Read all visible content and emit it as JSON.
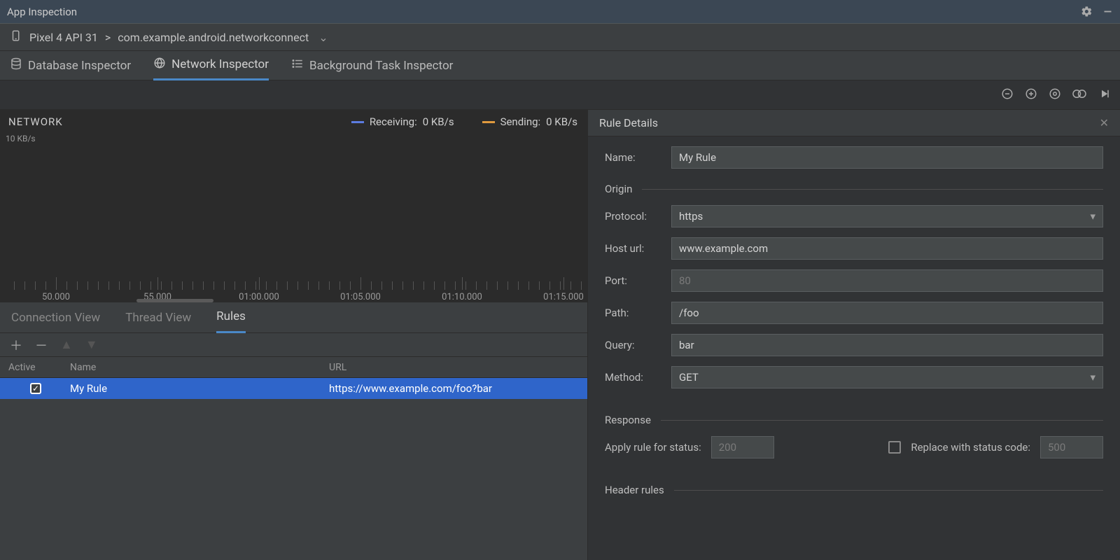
{
  "window": {
    "title": "App Inspection"
  },
  "breadcrumb": {
    "device": "Pixel 4 API 31",
    "sep": " > ",
    "package": "com.example.android.networkconnect"
  },
  "tabs": {
    "database": "Database Inspector",
    "network": "Network Inspector",
    "background": "Background Task Inspector",
    "active": "network"
  },
  "network": {
    "title": "NETWORK",
    "yaxis": "10 KB/s",
    "legend": {
      "receiving_label": "Receiving:",
      "receiving_value": "0 KB/s",
      "sending_label": "Sending:",
      "sending_value": "0 KB/s"
    },
    "timeline_ticks": [
      "50.000",
      "55.000",
      "01:00.000",
      "01:05.000",
      "01:10.000",
      "01:15.000"
    ]
  },
  "sub_tabs": {
    "connection": "Connection View",
    "thread": "Thread View",
    "rules": "Rules",
    "active": "rules"
  },
  "rules_table": {
    "headers": {
      "active": "Active",
      "name": "Name",
      "url": "URL"
    },
    "rows": [
      {
        "active": true,
        "name": "My Rule",
        "url": "https://www.example.com/foo?bar"
      }
    ]
  },
  "details": {
    "title": "Rule Details",
    "name_label": "Name:",
    "name_value": "My Rule",
    "sections": {
      "origin": "Origin",
      "response": "Response",
      "header_rules": "Header rules"
    },
    "origin": {
      "protocol_label": "Protocol:",
      "protocol_value": "https",
      "host_label": "Host url:",
      "host_value": "www.example.com",
      "port_label": "Port:",
      "port_placeholder": "80",
      "path_label": "Path:",
      "path_value": "/foo",
      "query_label": "Query:",
      "query_value": "bar",
      "method_label": "Method:",
      "method_value": "GET"
    },
    "response": {
      "apply_label": "Apply rule for status:",
      "apply_placeholder": "200",
      "replace_label": "Replace with status code:",
      "replace_placeholder": "500"
    }
  }
}
